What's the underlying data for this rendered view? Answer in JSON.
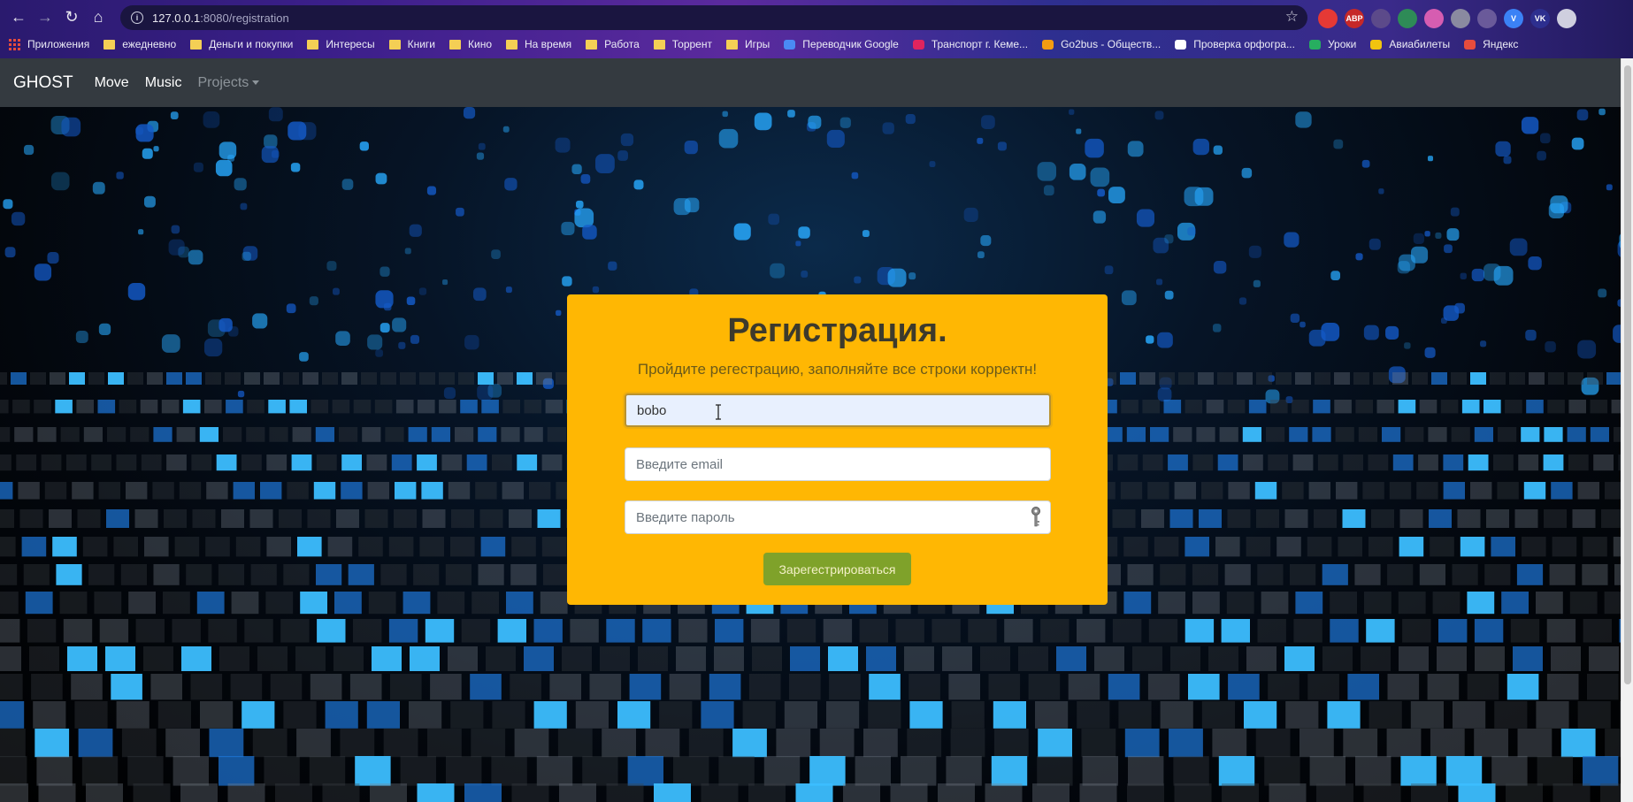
{
  "browser": {
    "url_host": "127.0.0.1",
    "url_path": ":8080/registration",
    "extensions": [
      {
        "name": "red-extension",
        "label": "",
        "color": "#e53935"
      },
      {
        "name": "abp-extension",
        "label": "ABP",
        "color": "#c62828"
      },
      {
        "name": "hand-extension",
        "label": "",
        "color": "#5c4a8a"
      },
      {
        "name": "shield-extension",
        "label": "",
        "color": "#2e8b57"
      },
      {
        "name": "pink-extension",
        "label": "",
        "color": "#d65db1"
      },
      {
        "name": "shield-gray-extension",
        "label": "",
        "color": "#8a8aa0"
      },
      {
        "name": "key-extension",
        "label": "",
        "color": "#6a5a9a"
      },
      {
        "name": "v-extension",
        "label": "V",
        "color": "#3b82f6"
      },
      {
        "name": "vk-extension",
        "label": "VK",
        "color": "#2d2f8f"
      },
      {
        "name": "profile-avatar",
        "label": "",
        "color": "#cfcfdf"
      }
    ],
    "bookmarks": [
      {
        "label": "Приложения",
        "icon": "apps-grid-icon"
      },
      {
        "label": "ежедневно",
        "icon": "folder-icon"
      },
      {
        "label": "Деньги и покупки",
        "icon": "folder-icon"
      },
      {
        "label": "Интересы",
        "icon": "folder-icon"
      },
      {
        "label": "Книги",
        "icon": "folder-icon"
      },
      {
        "label": "Кино",
        "icon": "folder-icon"
      },
      {
        "label": "На время",
        "icon": "folder-icon"
      },
      {
        "label": "Работа",
        "icon": "folder-icon"
      },
      {
        "label": "Торрент",
        "icon": "folder-icon"
      },
      {
        "label": "Игры",
        "icon": "folder-icon"
      },
      {
        "label": "Переводчик Google",
        "icon": "translate-icon"
      },
      {
        "label": "Транспорт г. Кеме...",
        "icon": "transport-icon"
      },
      {
        "label": "Go2bus - Обществ...",
        "icon": "bus-icon"
      },
      {
        "label": "Проверка орфогра...",
        "icon": "spellcheck-icon"
      },
      {
        "label": "Уроки",
        "icon": "lessons-icon"
      },
      {
        "label": "Авиабилеты",
        "icon": "plane-icon"
      },
      {
        "label": "Яндекс",
        "icon": "yandex-icon"
      }
    ]
  },
  "navbar": {
    "brand": "GHOST",
    "links": [
      "Move",
      "Music"
    ],
    "dropdown": "Projects"
  },
  "form": {
    "title": "Регистрация.",
    "subtitle": "Пройдите регестрацию, заполняйте все строки корректн!",
    "name_value": "bobo",
    "email_placeholder": "Введите email",
    "password_placeholder": "Введите пароль",
    "submit_label": "Зарегестрироваться"
  },
  "colors": {
    "card": "#ffb703",
    "button": "#7fa22a",
    "navbar": "#343a40"
  }
}
